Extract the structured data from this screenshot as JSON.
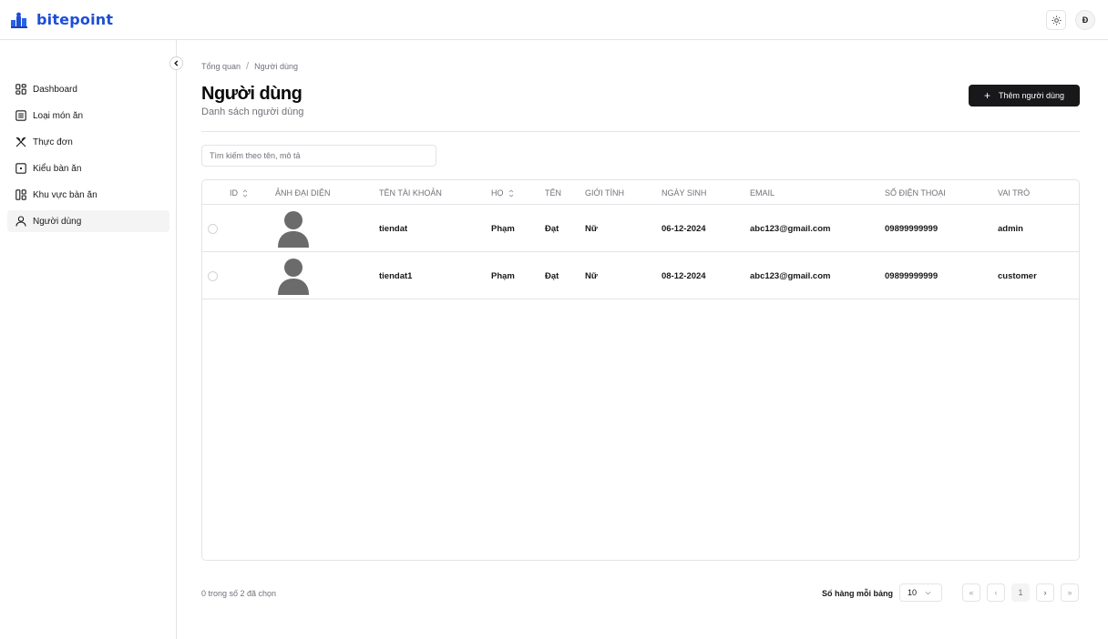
{
  "app": {
    "brand": "bitepoint",
    "brand_color": "#1d4ed8",
    "user_initial": "Đ"
  },
  "sidebar": {
    "items": [
      {
        "label": "Dashboard",
        "icon": "dashboard-grid-icon",
        "active": false
      },
      {
        "label": "Loại món ăn",
        "icon": "list-icon",
        "active": false
      },
      {
        "label": "Thực đơn",
        "icon": "utensils-icon",
        "active": false
      },
      {
        "label": "Kiểu bàn ăn",
        "icon": "square-dot-icon",
        "active": false
      },
      {
        "label": "Khu vực bàn ăn",
        "icon": "layout-icon",
        "active": false
      },
      {
        "label": "Người dùng",
        "icon": "user-icon",
        "active": true
      }
    ]
  },
  "breadcrumb": {
    "root": "Tổng quan",
    "separator": "/",
    "current": "Người dùng"
  },
  "page": {
    "title": "Người dùng",
    "subtitle": "Danh sách người dùng",
    "add_button": "Thêm người dùng"
  },
  "search": {
    "placeholder": "Tìm kiếm theo tên, mô tả",
    "value": ""
  },
  "table": {
    "headers": {
      "id": "ID",
      "avatar": "ẢNH ĐẠI DIỆN",
      "username": "TÊN TÀI KHOẢN",
      "last_name": "HỌ",
      "first_name": "TÊN",
      "gender": "GIỚI TÍNH",
      "birthday": "NGÀY SINH",
      "email": "EMAIL",
      "phone": "SỐ ĐIỆN THOẠI",
      "role": "VAI TRÒ"
    },
    "rows": [
      {
        "username": "tiendat",
        "last_name": "Phạm",
        "first_name": "Đạt",
        "gender": "Nữ",
        "birthday": "06-12-2024",
        "email": "abc123@gmail.com",
        "phone": "09899999999",
        "role": "admin"
      },
      {
        "username": "tiendat1",
        "last_name": "Phạm",
        "first_name": "Đạt",
        "gender": "Nữ",
        "birthday": "08-12-2024",
        "email": "abc123@gmail.com",
        "phone": "09899999999",
        "role": "customer"
      }
    ]
  },
  "footer": {
    "selection": "0 trong số 2 đã chọn",
    "rows_per_page_label": "Số hàng mỗi bảng",
    "rows_per_page": "10",
    "current_page": "1",
    "first_icon": "«",
    "prev_icon": "‹",
    "next_icon": "›",
    "last_icon": "»"
  }
}
